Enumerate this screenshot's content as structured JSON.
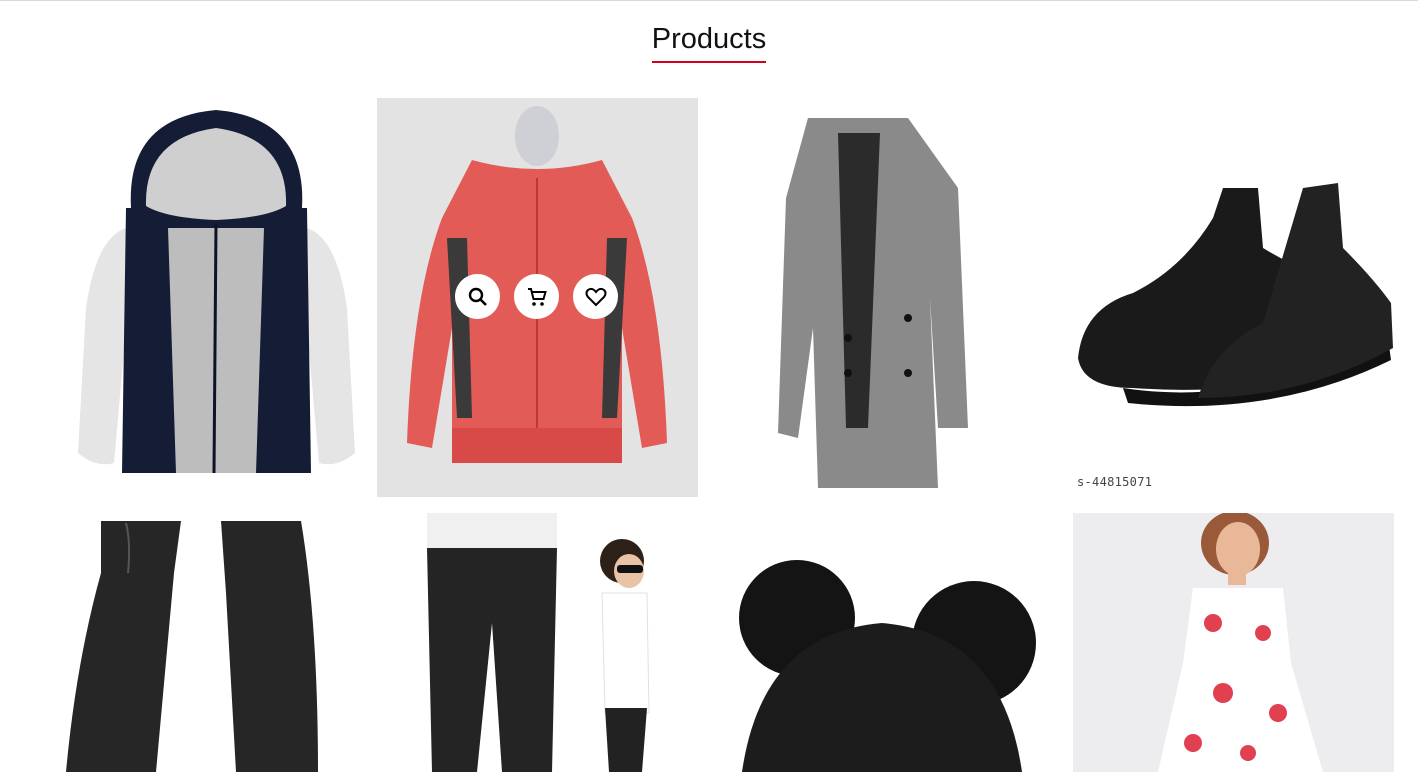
{
  "section": {
    "title": "Products"
  },
  "products": [
    {
      "name": "hoodie"
    },
    {
      "name": "red-jacket",
      "overlay_actions": [
        {
          "icon": "search-icon"
        },
        {
          "icon": "cart-icon"
        },
        {
          "icon": "heart-icon"
        }
      ]
    },
    {
      "name": "grey-coat"
    },
    {
      "name": "black-sneakers",
      "label": "s-44815071"
    },
    {
      "name": "black-jeans"
    },
    {
      "name": "kids-jeans"
    },
    {
      "name": "pompom-beanie"
    },
    {
      "name": "floral-dress"
    }
  ],
  "colors": {
    "accent": "#d0021b"
  }
}
